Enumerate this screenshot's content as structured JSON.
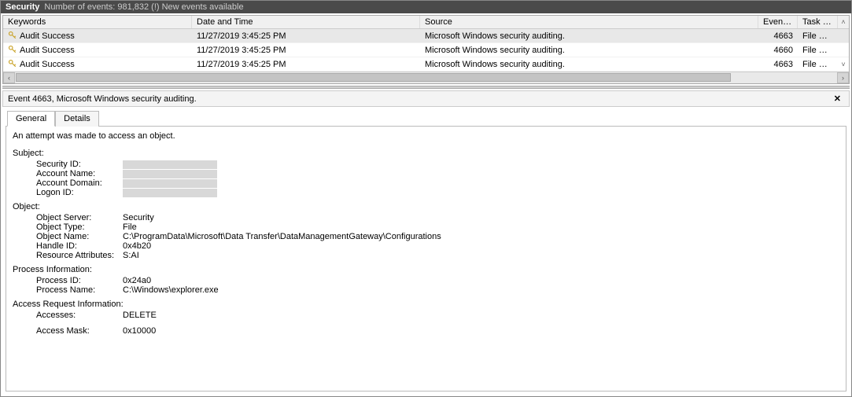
{
  "titlebar": {
    "group": "Security",
    "event_count_label": "Number of events: 981,832 (!) New events available"
  },
  "grid": {
    "headers": {
      "keywords": "Keywords",
      "date": "Date and Time",
      "source": "Source",
      "event_id": "Event ID",
      "task": "Task Category"
    },
    "rows": [
      {
        "keywords": "Audit Success",
        "date": "11/27/2019 3:45:25 PM",
        "source": "Microsoft Windows security auditing.",
        "event_id": "4663",
        "task": "File System",
        "selected": true
      },
      {
        "keywords": "Audit Success",
        "date": "11/27/2019 3:45:25 PM",
        "source": "Microsoft Windows security auditing.",
        "event_id": "4660",
        "task": "File System",
        "selected": false
      },
      {
        "keywords": "Audit Success",
        "date": "11/27/2019 3:45:25 PM",
        "source": "Microsoft Windows security auditing.",
        "event_id": "4663",
        "task": "File System",
        "selected": false
      }
    ]
  },
  "detail": {
    "title": "Event 4663, Microsoft Windows security auditing.",
    "tabs": {
      "general": "General",
      "details": "Details"
    },
    "message": "An attempt was made to access an object.",
    "subject_label": "Subject:",
    "subject": {
      "security_id_k": "Security ID:",
      "account_name_k": "Account Name:",
      "account_domain_k": "Account Domain:",
      "logon_id_k": "Logon ID:"
    },
    "object_label": "Object:",
    "object": {
      "server_k": "Object Server:",
      "server_v": "Security",
      "type_k": "Object Type:",
      "type_v": "File",
      "name_k": "Object Name:",
      "name_v": "C:\\ProgramData\\Microsoft\\Data Transfer\\DataManagementGateway\\Configurations",
      "handle_k": "Handle ID:",
      "handle_v": "0x4b20",
      "resattr_k": "Resource Attributes:",
      "resattr_v": "S:AI"
    },
    "process_label": "Process Information:",
    "process": {
      "pid_k": "Process ID:",
      "pid_v": "0x24a0",
      "pname_k": "Process Name:",
      "pname_v": "C:\\Windows\\explorer.exe"
    },
    "access_label": "Access Request Information:",
    "access": {
      "accesses_k": "Accesses:",
      "accesses_v": "DELETE",
      "mask_k": "Access Mask:",
      "mask_v": "0x10000"
    }
  }
}
